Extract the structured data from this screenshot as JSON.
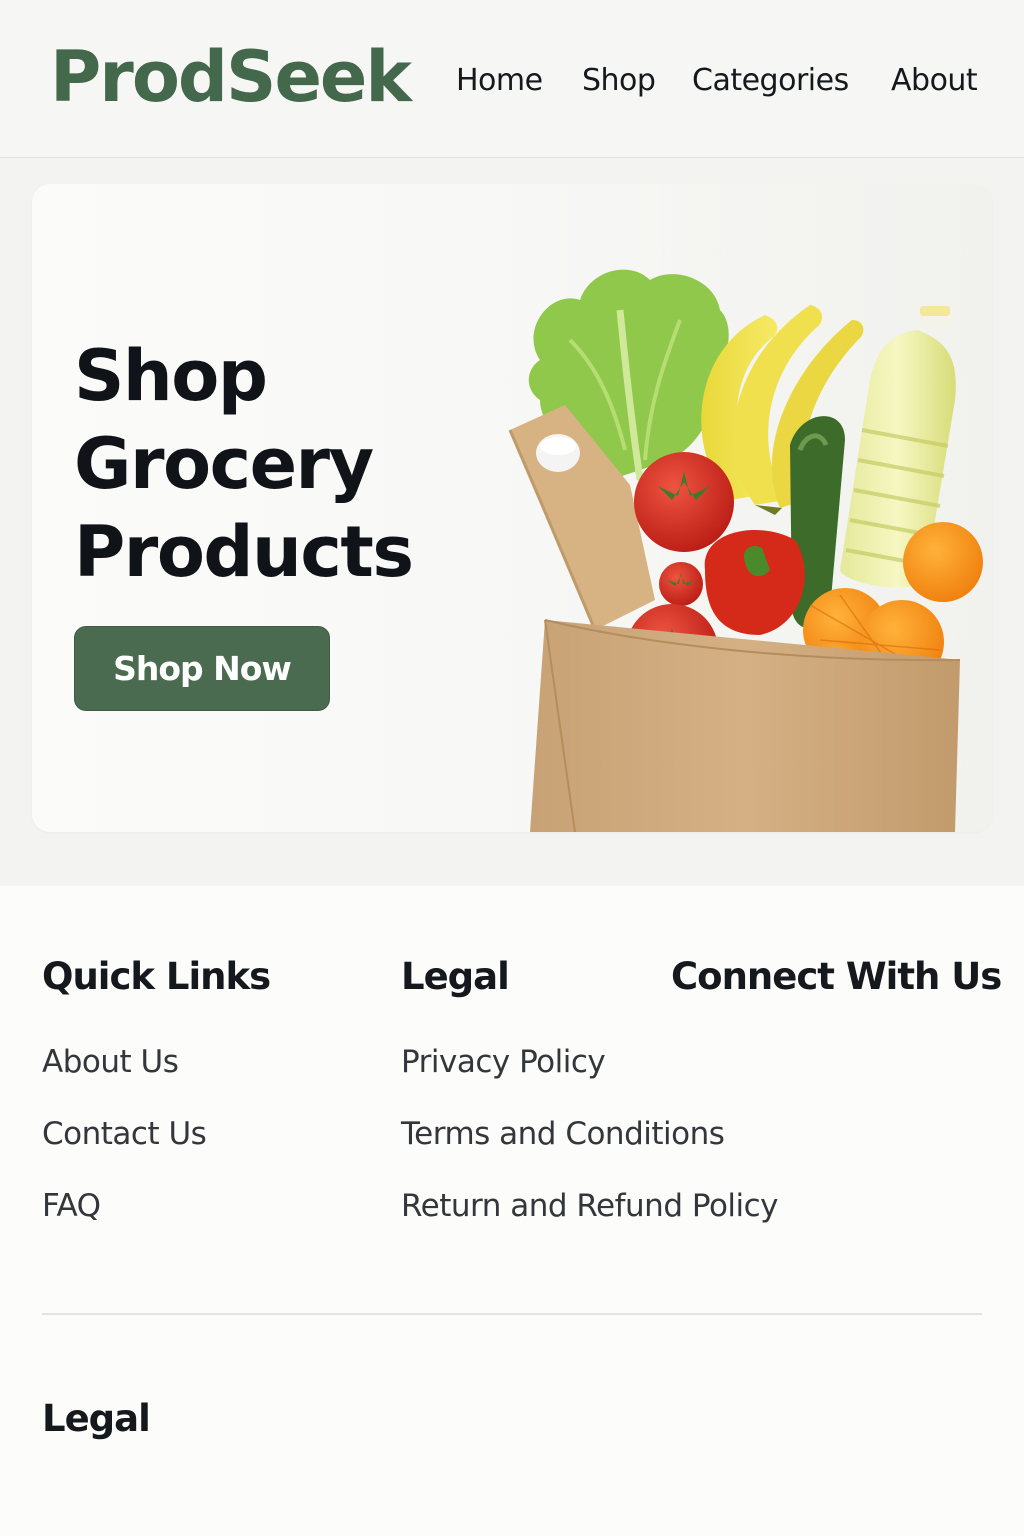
{
  "brand": {
    "logo": "ProdSeek",
    "accent": "#44684b"
  },
  "nav": [
    {
      "label": "Home"
    },
    {
      "label": "Shop"
    },
    {
      "label": "Categories"
    },
    {
      "label": "About"
    }
  ],
  "hero": {
    "title_lines": [
      "Shop",
      "Grocery",
      "Products"
    ],
    "cta_label": "Shop Now",
    "image": "grocery-bag-illustration"
  },
  "footer": {
    "columns": [
      {
        "heading": "Quick Links",
        "links": [
          "About Us",
          "Contact Us",
          "FAQ"
        ]
      },
      {
        "heading": "Legal",
        "links": [
          "Privacy Policy",
          "Terms and Conditions",
          "Return and Refund Policy"
        ]
      },
      {
        "heading": "Connect With Us",
        "links": []
      }
    ],
    "bottom_heading": "Legal"
  }
}
